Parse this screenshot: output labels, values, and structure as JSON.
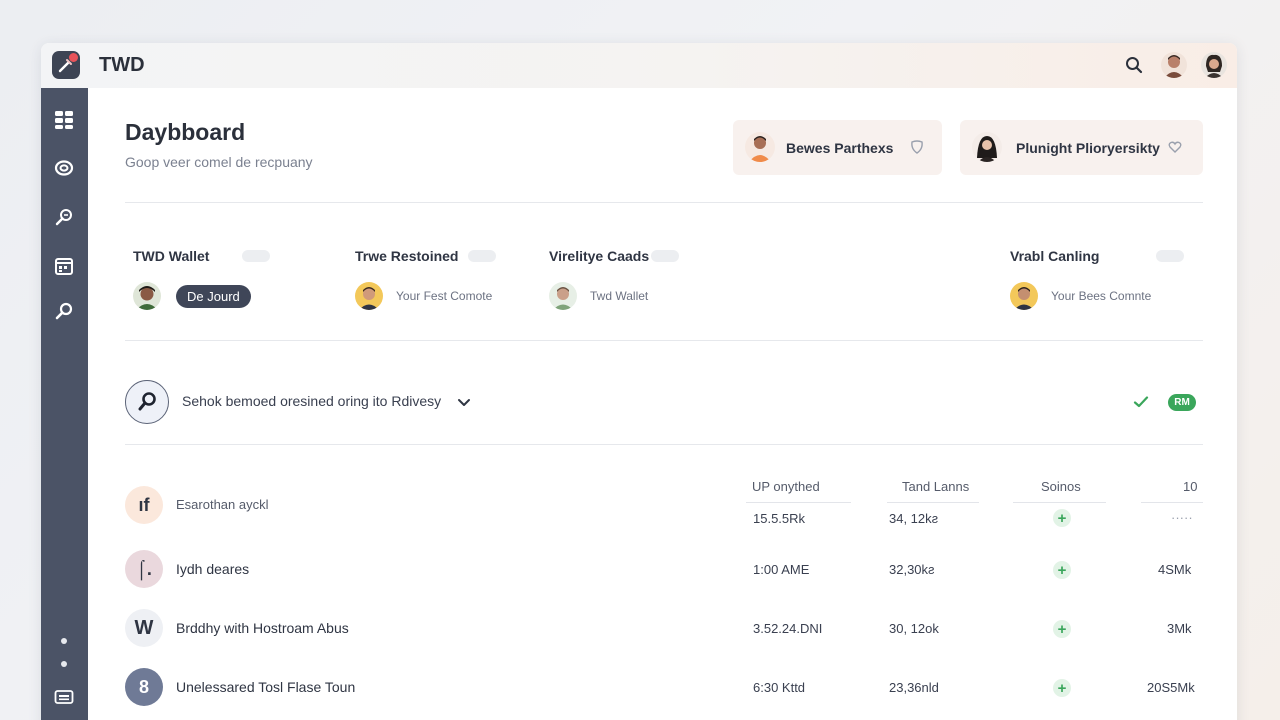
{
  "app": {
    "title": "TWD"
  },
  "sidebar": {
    "icons": [
      "grid-icon",
      "ring-icon",
      "search-key-icon",
      "calendar-icon",
      "search-icon"
    ],
    "bottom_icon": "keyboard-icon"
  },
  "header": {
    "title": "Daybboard",
    "subtitle": "Goop veer comel de recpuany"
  },
  "profiles": [
    {
      "name": "Bewes Parthexs"
    },
    {
      "name": "Plunight Plioryersikty"
    }
  ],
  "wallets": [
    {
      "title": "TWD Wallet",
      "pill": "De Jourd"
    },
    {
      "title": "Trwe Restoined",
      "text": "Your Fest Comote"
    },
    {
      "title": "Virelitye Caads",
      "text": "Twd Wallet"
    },
    {
      "title": "Vrabl Canling",
      "text": "Your Bees Comnte"
    }
  ],
  "search": {
    "text": "Sehok bemoed oresined oring ito Rdivesy",
    "badge": "RM"
  },
  "table": {
    "headers": [
      "UP onythed",
      "Tand Lanns",
      "Soinos",
      "10"
    ],
    "rows": [
      {
        "icon_text": "ıf",
        "name": "Esarothan ayckl",
        "c1": "15.5.5Rk",
        "c2": "34, 12kƨ",
        "c4": "·····"
      },
      {
        "icon_text": "⌠.",
        "name": "Iydh deares",
        "c1": "1:00 AME",
        "c2": "32,30kƨ",
        "c4": "4SMk"
      },
      {
        "icon_text": "W",
        "name": "Brddhy with Hostroam Abus",
        "c1": "3.52.24.DNI",
        "c2": "30, 12ok",
        "c4": "3Mk"
      },
      {
        "icon_text": "8",
        "name": "Unelessared Tosl Flase Toun",
        "c1": "6:30 Kttd",
        "c2": "23,36nld",
        "c4": "20S5Mk"
      }
    ]
  },
  "colors": {
    "sidebar": "#4b5366",
    "accent_green": "#3aa65b",
    "pill_dark": "#3f4658"
  }
}
